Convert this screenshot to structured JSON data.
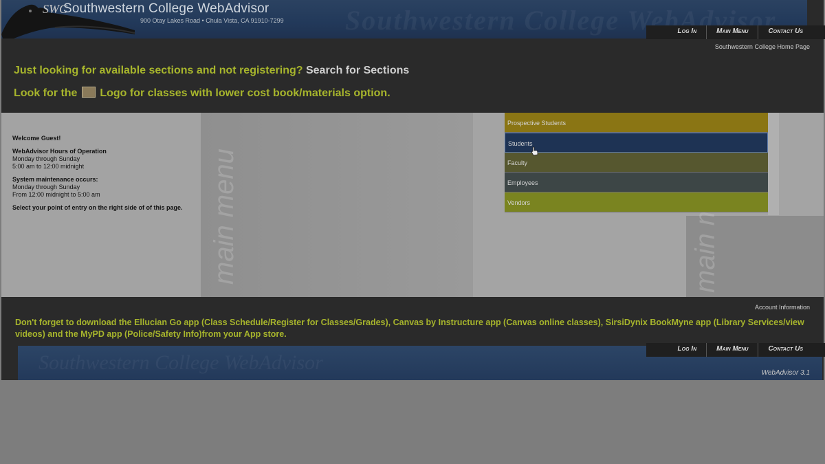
{
  "header": {
    "logo_mark": "SWC",
    "title": "Southwestern College WebAdvisor",
    "address": "900 Otay Lakes Road • Chula Vista, CA 91910-7299",
    "faint_text": "Southwestern College WebAdvisor"
  },
  "nav": {
    "items": [
      "Log In",
      "Main Menu",
      "Contact Us"
    ]
  },
  "home_link": "Southwestern College Home Page",
  "notices": {
    "line1_text": "Just looking for available sections and not registering?",
    "line1_link": "Search for Sections",
    "line2_prefix": "Look for the",
    "line2_suffix": "Logo for classes with lower cost book/materials option."
  },
  "watermark": "main menu",
  "info": {
    "welcome": "Welcome Guest!",
    "hours_title": "WebAdvisor Hours of Operation",
    "hours_days": "Monday through Sunday",
    "hours_time": "5:00 am to 12:00 midnight",
    "maint_title": "System maintenance occurs:",
    "maint_days": "Monday through Sunday",
    "maint_time": "From 12:00 midnight to 5:00 am",
    "select_note": "Select your point of entry on the right side of of this page."
  },
  "entry_menu": [
    {
      "label": "Prospective Students",
      "color": "#8a7514"
    },
    {
      "label": "Students",
      "color": "#1e3354"
    },
    {
      "label": "Faculty",
      "color": "#56572f"
    },
    {
      "label": "Employees",
      "color": "#3d4646"
    },
    {
      "label": "Vendors",
      "color": "#7a8420"
    }
  ],
  "footer": {
    "account_info": "Account Information",
    "message": "Don't forget to download the Ellucian Go app (Class Schedule/Register for Classes/Grades), Canvas by Instructure app (Canvas online classes), SirsiDynix BookMyne app (Library Services/view videos) and the MyPD app (Police/Safety Info)from your App store.",
    "version": "WebAdvisor 3.1",
    "faint_text": "Southwestern College WebAdvisor"
  },
  "colors": {
    "notice": "#a7b52c",
    "banner": "#22395a"
  }
}
